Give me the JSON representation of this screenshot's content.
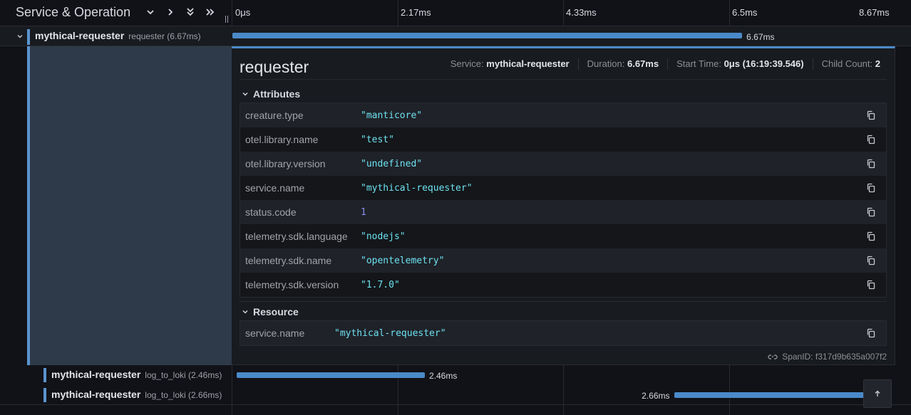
{
  "header": {
    "title": "Service & Operation",
    "ticks": [
      "0μs",
      "2.17ms",
      "4.33ms",
      "6.5ms",
      "8.67ms"
    ]
  },
  "root_span": {
    "service": "mythical-requester",
    "operation": "requester (6.67ms)",
    "bar_label": "6.67ms",
    "duration_fraction": 0.769
  },
  "detail": {
    "title": "requester",
    "meta": {
      "service_label": "Service:",
      "service_value": "mythical-requester",
      "duration_label": "Duration:",
      "duration_value": "6.67ms",
      "start_label": "Start Time:",
      "start_value": "0μs (16:19:39.546)",
      "child_label": "Child Count:",
      "child_value": "2"
    },
    "attributes_header": "Attributes",
    "attributes": [
      {
        "key": "creature.type",
        "value": "\"manticore\""
      },
      {
        "key": "otel.library.name",
        "value": "\"test\""
      },
      {
        "key": "otel.library.version",
        "value": "\"undefined\""
      },
      {
        "key": "service.name",
        "value": "\"mythical-requester\""
      },
      {
        "key": "status.code",
        "value": "1"
      },
      {
        "key": "telemetry.sdk.language",
        "value": "\"nodejs\""
      },
      {
        "key": "telemetry.sdk.name",
        "value": "\"opentelemetry\""
      },
      {
        "key": "telemetry.sdk.version",
        "value": "\"1.7.0\""
      }
    ],
    "resource_header": "Resource",
    "resource": [
      {
        "key": "service.name",
        "value": "\"mythical-requester\""
      }
    ],
    "span_id_label": "SpanID:",
    "span_id_value": "f317d9b635a007f2"
  },
  "child_spans": [
    {
      "service": "mythical-requester",
      "operation": "log_to_loki (2.46ms)",
      "bar_label": "2.46ms",
      "start_ms": 0.0,
      "duration_ms": 2.46
    },
    {
      "service": "mythical-requester",
      "operation": "log_to_loki (2.66ms)",
      "bar_label": "2.66ms",
      "start_ms": 6.2,
      "duration_ms": 2.66
    }
  ],
  "colors": {
    "accent": "#4a8ac9",
    "value": "#6ce0f0",
    "number": "#8a8ef0"
  },
  "icons": [
    "chevron-down-icon",
    "chevron-right-icon",
    "double-chevron-down-icon",
    "double-chevron-right-icon",
    "copy-icon",
    "link-icon",
    "arrow-up-icon"
  ]
}
